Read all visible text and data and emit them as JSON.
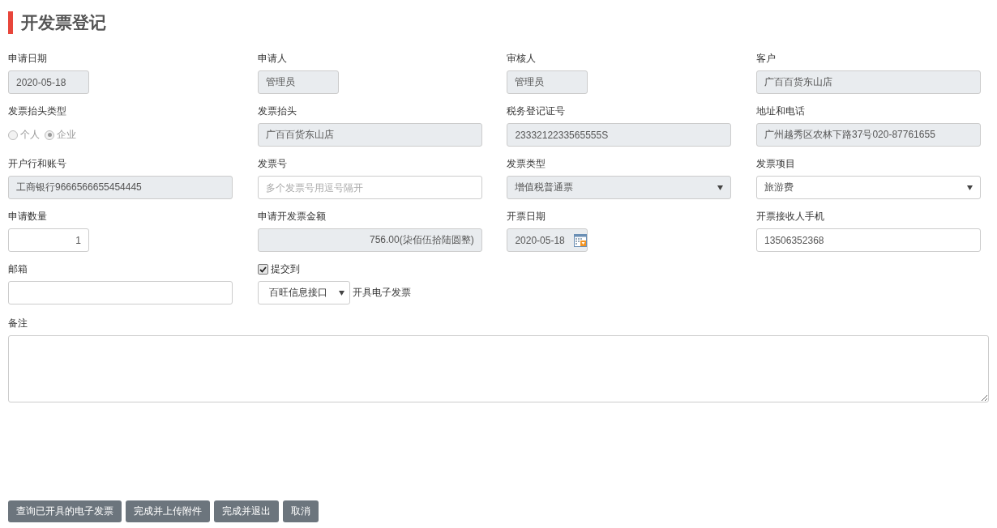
{
  "title": "开发票登记",
  "fields": [
    {
      "kind": "short",
      "label": "申请日期",
      "value": "2020-05-18",
      "readonly": true
    },
    {
      "kind": "short",
      "label": "申请人",
      "value": "管理员",
      "readonly": true
    },
    {
      "kind": "short",
      "label": "审核人",
      "value": "管理员",
      "readonly": true
    },
    {
      "kind": "text",
      "label": "客户",
      "value": "广百百货东山店",
      "readonly": true
    },
    {
      "kind": "radio",
      "label": "发票抬头类型",
      "disabled": true,
      "options": [
        {
          "label": "个人",
          "selected": false
        },
        {
          "label": "企业",
          "selected": true
        }
      ]
    },
    {
      "kind": "text",
      "label": "发票抬头",
      "value": "广百百货东山店",
      "readonly": true
    },
    {
      "kind": "text",
      "label": "税务登记证号",
      "value": "2333212233565555S",
      "readonly": true
    },
    {
      "kind": "text",
      "label": "地址和电话",
      "value": "广州越秀区农林下路37号020-87761655",
      "readonly": true
    },
    {
      "kind": "text",
      "label": "开户行和账号",
      "value": "工商银行9666566655454445",
      "readonly": true
    },
    {
      "kind": "text",
      "label": "发票号",
      "placeholder": "多个发票号用逗号隔开",
      "readonly": false
    },
    {
      "kind": "select",
      "label": "发票类型",
      "value": "增值税普通票",
      "readonly": true
    },
    {
      "kind": "select",
      "label": "发票项目",
      "value": "旅游费",
      "readonly": false
    },
    {
      "kind": "number",
      "label": "申请数量",
      "value": "1",
      "readonly": false
    },
    {
      "kind": "amount",
      "label": "申请开发票金额",
      "value": "756.00(柒佰伍拾陆圆整)",
      "readonly": true
    },
    {
      "kind": "date",
      "label": "开票日期",
      "value": "2020-05-18",
      "readonly": true
    },
    {
      "kind": "text",
      "label": "开票接收人手机",
      "value": "13506352368",
      "readonly": false
    },
    {
      "kind": "text",
      "label": "邮箱",
      "readonly": false
    },
    {
      "kind": "submit",
      "label": "提交到",
      "checked": true,
      "value": "百旺信息接口",
      "suffix": "开具电子发票"
    }
  ],
  "remark": {
    "label": "备注"
  },
  "buttons": [
    "查询已开具的电子发票",
    "完成并上传附件",
    "完成并退出",
    "取消"
  ]
}
